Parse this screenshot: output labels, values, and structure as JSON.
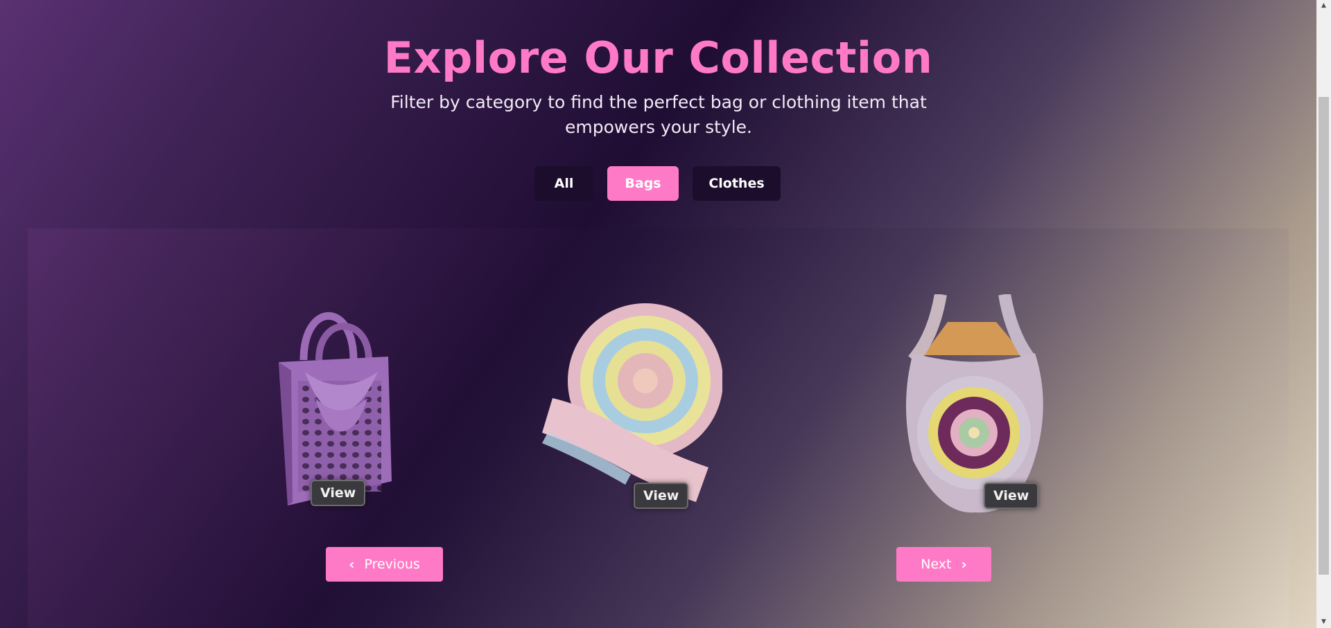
{
  "header": {
    "title": "Explore Our Collection",
    "subtitle": "Filter by category to find the perfect bag or clothing item that empowers your style."
  },
  "filters": {
    "items": [
      "All",
      "Bags",
      "Clothes"
    ],
    "active": "Bags"
  },
  "products": [
    {
      "name": "purple crochet tote bag",
      "view_label": "View"
    },
    {
      "name": "round pastel crochet crossbody bag",
      "view_label": "View"
    },
    {
      "name": "pastel granny square crochet tote bag",
      "view_label": "View"
    }
  ],
  "navigation": {
    "previous_label": "Previous",
    "next_label": "Next"
  },
  "icons": {
    "previous": "chevron-left-icon",
    "next": "chevron-right-icon",
    "scroll_up": "scroll-up-arrow-icon",
    "scroll_down": "scroll-down-arrow-icon"
  },
  "colors": {
    "accent": "#ff7ac6",
    "filter_inactive": "#1b0d2b",
    "view_button": "#3a3a3e"
  }
}
